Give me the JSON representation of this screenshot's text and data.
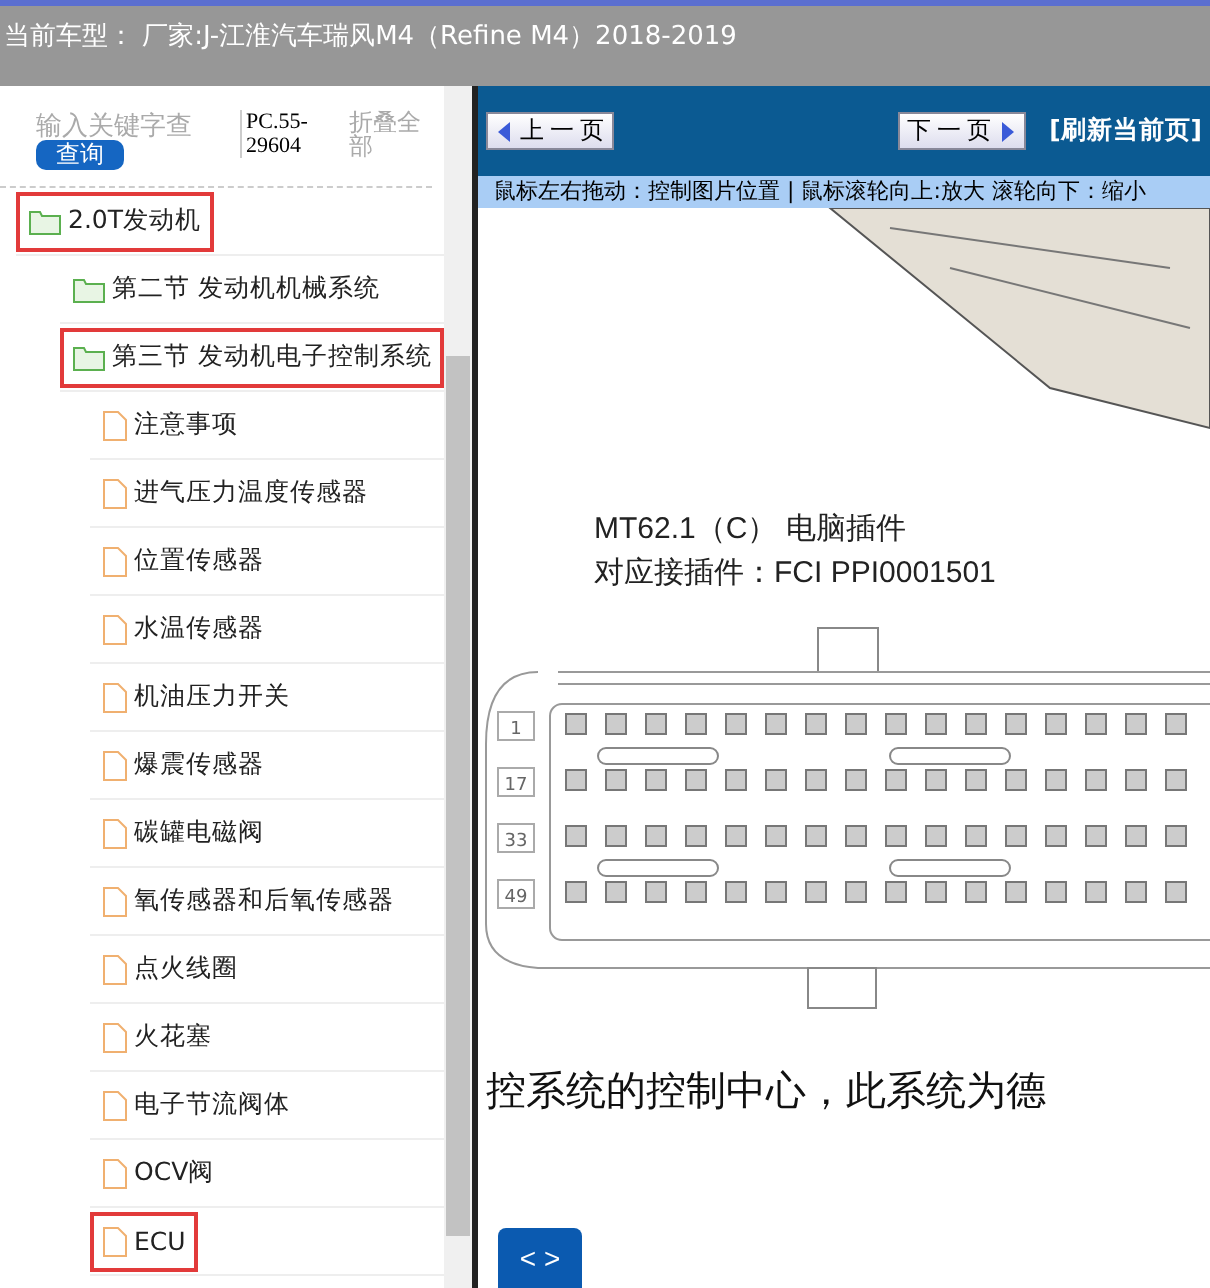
{
  "header": {
    "title": "当前车型：  厂家:J-江淮汽车瑞风M4（Refine M4）2018-2019"
  },
  "search": {
    "placeholder": "输入关键字查",
    "button": "查询",
    "code": "PC.55-29604",
    "collapse": "折叠全部"
  },
  "tree": [
    {
      "label": "2.0T发动机",
      "kind": "folder",
      "highlighted": true,
      "children": [
        {
          "label": "第二节 发动机机械系统",
          "kind": "folder",
          "highlighted": false
        },
        {
          "label": "第三节 发动机电子控制系统",
          "kind": "folder",
          "highlighted": true,
          "children": [
            {
              "label": "注意事项",
              "kind": "doc",
              "highlighted": false
            },
            {
              "label": "进气压力温度传感器",
              "kind": "doc",
              "highlighted": false
            },
            {
              "label": "位置传感器",
              "kind": "doc",
              "highlighted": false
            },
            {
              "label": "水温传感器",
              "kind": "doc",
              "highlighted": false
            },
            {
              "label": "机油压力开关",
              "kind": "doc",
              "highlighted": false
            },
            {
              "label": "爆震传感器",
              "kind": "doc",
              "highlighted": false
            },
            {
              "label": "碳罐电磁阀",
              "kind": "doc",
              "highlighted": false
            },
            {
              "label": "氧传感器和后氧传感器",
              "kind": "doc",
              "highlighted": false
            },
            {
              "label": "点火线圈",
              "kind": "doc",
              "highlighted": false
            },
            {
              "label": "火花塞",
              "kind": "doc",
              "highlighted": false
            },
            {
              "label": "电子节流阀体",
              "kind": "doc",
              "highlighted": false
            },
            {
              "label": "OCV阀",
              "kind": "doc",
              "highlighted": false
            },
            {
              "label": "ECU",
              "kind": "doc",
              "highlighted": true
            }
          ]
        }
      ]
    }
  ],
  "viewer": {
    "prev": "上 一 页",
    "next": "下 一 页",
    "refresh": "[刷新当前页]",
    "hint": "鼠标左右拖动：控制图片位置 | 鼠标滚轮向上:放大  滚轮向下：缩小",
    "nav": "< >"
  },
  "document": {
    "heading": "MT62.1（C） 电脑插件",
    "subheading": "对应接插件：FCI PPI0001501",
    "pin_rows": [
      "1",
      "17",
      "33",
      "49"
    ],
    "body": "控系统的控制中心，此系统为德"
  }
}
